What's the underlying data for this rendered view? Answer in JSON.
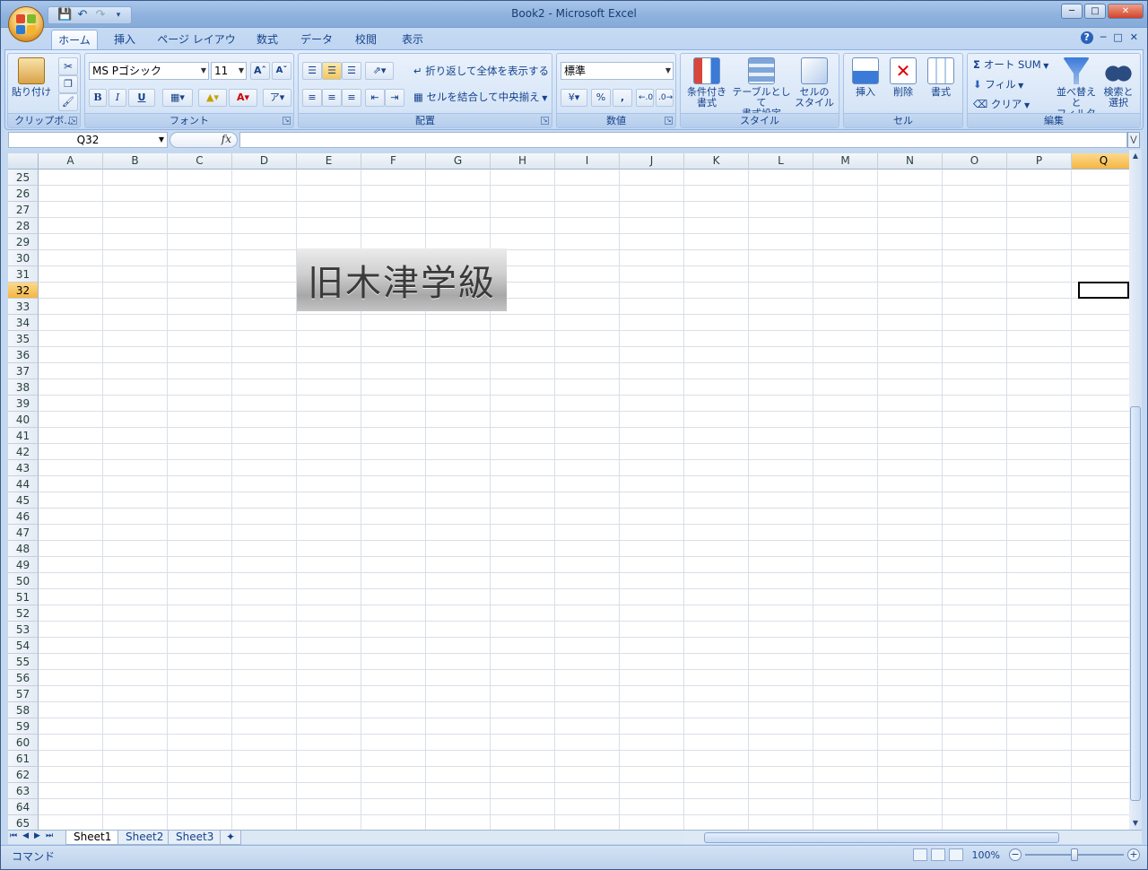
{
  "window": {
    "title": "Book2 - Microsoft Excel"
  },
  "tabs": [
    "ホーム",
    "挿入",
    "ページ レイアウト",
    "数式",
    "データ",
    "校閲",
    "表示"
  ],
  "ribbon": {
    "clipboard": {
      "label": "クリップボ...",
      "paste": "貼り付け"
    },
    "font": {
      "label": "フォント",
      "name": "MS Pゴシック",
      "size": "11",
      "bold": "B",
      "italic": "I",
      "underline": "U"
    },
    "alignment": {
      "label": "配置",
      "wrap": "折り返して全体を表示する",
      "merge": "セルを結合して中央揃え"
    },
    "number": {
      "label": "数値",
      "format": "標準",
      "percent": "%",
      "comma": ","
    },
    "styles": {
      "label": "スタイル",
      "conditional": [
        "条件付き",
        "書式"
      ],
      "table": [
        "テーブルとして",
        "書式設定"
      ],
      "cell": [
        "セルの",
        "スタイル"
      ]
    },
    "cells": {
      "label": "セル",
      "insert": "挿入",
      "delete": "削除",
      "format": "書式"
    },
    "editing": {
      "label": "編集",
      "autosum": "オート SUM",
      "fill": "フィル",
      "clear": "クリア",
      "sort": [
        "並べ替えと",
        "フィルタ"
      ],
      "find": [
        "検索と",
        "選択"
      ]
    }
  },
  "formula_bar": {
    "name_box": "Q32",
    "fx": "fx",
    "formula": ""
  },
  "columns": [
    "A",
    "B",
    "C",
    "D",
    "E",
    "F",
    "G",
    "H",
    "I",
    "J",
    "K",
    "L",
    "M",
    "N",
    "O",
    "P",
    "Q"
  ],
  "selected_column": "Q",
  "rows": [
    "25",
    "26",
    "27",
    "28",
    "29",
    "30",
    "31",
    "32",
    "33",
    "34",
    "35",
    "36",
    "37",
    "38",
    "39",
    "40",
    "41",
    "42",
    "43",
    "44",
    "45",
    "46",
    "47",
    "48",
    "49",
    "50",
    "51",
    "52",
    "53",
    "54",
    "55",
    "56",
    "57",
    "58",
    "59",
    "60",
    "61",
    "62",
    "63",
    "64",
    "65"
  ],
  "selected_row": "32",
  "overlay_text": "旧木津学級",
  "sheets": [
    "Sheet1",
    "Sheet2",
    "Sheet3"
  ],
  "status": {
    "mode": "コマンド",
    "zoom": "100%"
  },
  "zoom_level": 0.5
}
